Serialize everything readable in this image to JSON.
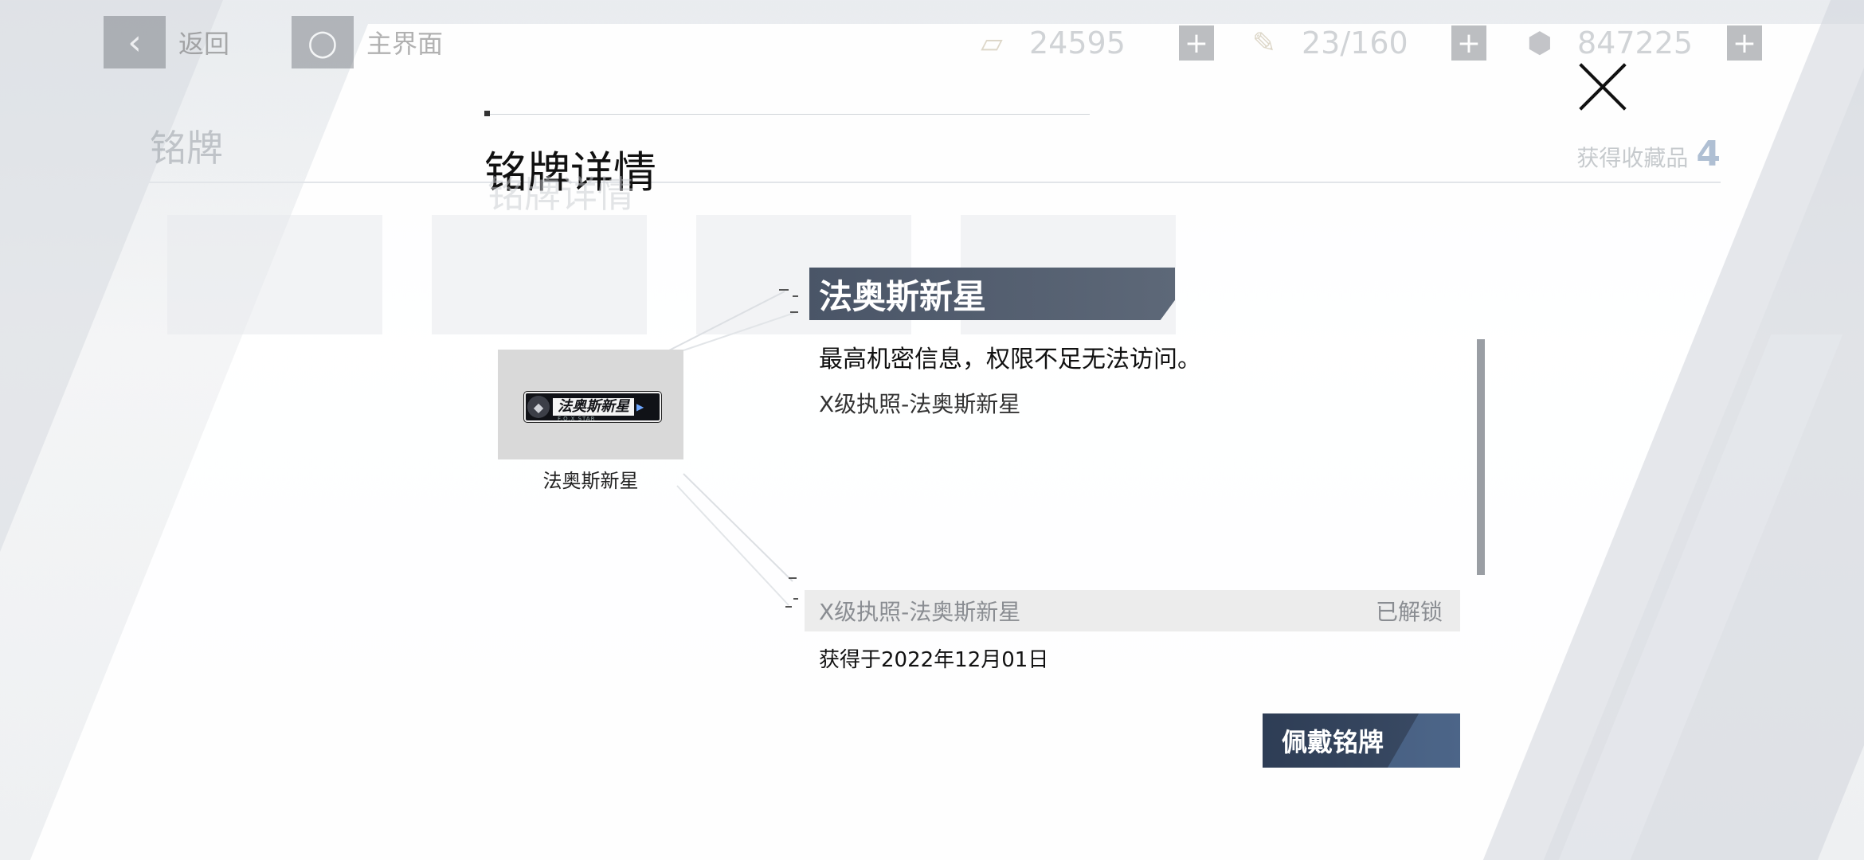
{
  "topbar": {
    "back_label": "返回",
    "home_label": "主界面",
    "resources": [
      {
        "icon": "ticket-icon",
        "value": "24595"
      },
      {
        "icon": "stamina-icon",
        "value": "23/160"
      },
      {
        "icon": "coin-icon",
        "value": "847225"
      }
    ]
  },
  "background": {
    "section_title": "铭牌",
    "collected_label": "获得收藏品",
    "collected_count": "4"
  },
  "dialog": {
    "title": "铭牌详情",
    "badge_tile": {
      "plate_text": "法奥斯新星",
      "plate_sub": "F.O.X STAR",
      "caption": "法奥斯新星"
    },
    "header": "法奥斯新星",
    "description": "最高机密信息，权限不足无法访问。",
    "license": "X级执照-法奥斯新星",
    "unlock_row": {
      "name": "X级执照-法奥斯新星",
      "status": "已解锁"
    },
    "obtained": "获得于2022年12月01日",
    "equip_label": "佩戴铭牌"
  }
}
